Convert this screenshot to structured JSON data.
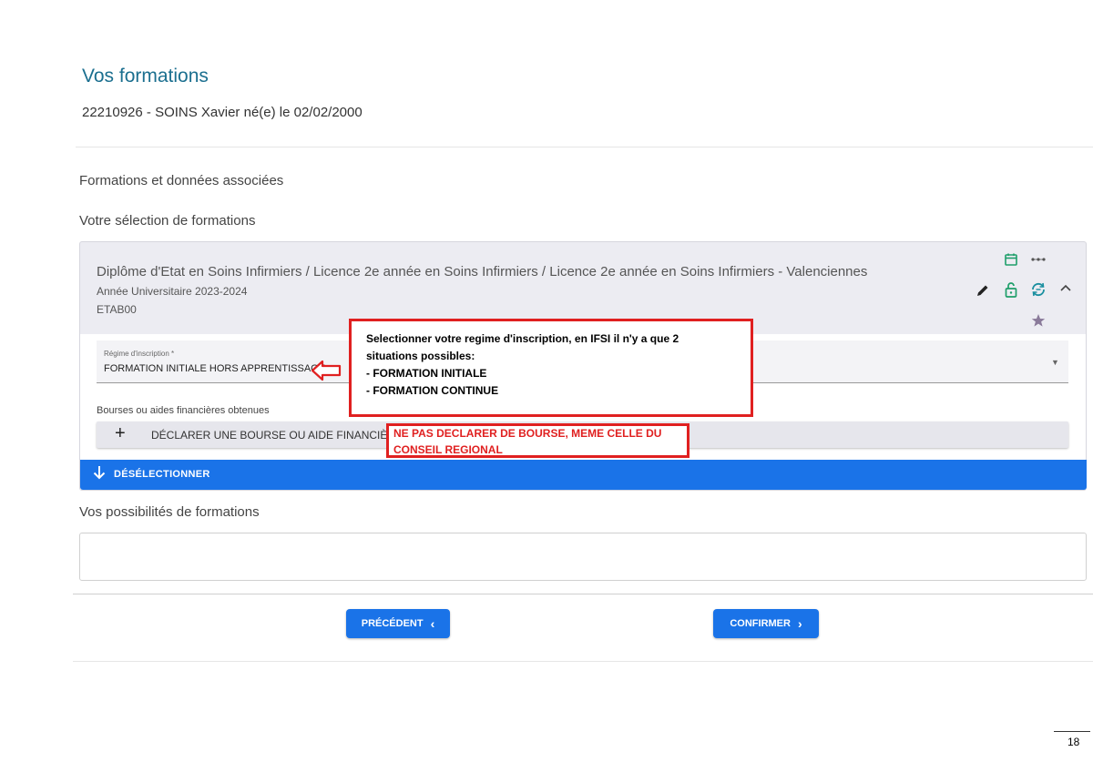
{
  "page": {
    "title": "Vos formations",
    "student": "22210926 - SOINS Xavier né(e) le 02/02/2000",
    "page_number": "18"
  },
  "sections": {
    "formations": "Formations et données associées",
    "selection": "Votre sélection de formations",
    "possibilites": "Vos possibilités de formations"
  },
  "formation": {
    "title": "Diplôme d'Etat en Soins Infirmiers / Licence 2e année en Soins Infirmiers / Licence 2e année en Soins Infirmiers - Valenciennes",
    "year": "Année Universitaire 2023-2024",
    "etab": "ETAB00",
    "icons": [
      "calendar-icon",
      "more-icon",
      "edit-icon",
      "lock-open-icon",
      "sync-icon",
      "chevron-up-icon",
      "star-icon"
    ],
    "icon_color_green": "#1e9e6a",
    "icon_color_teal": "#1a8fa0"
  },
  "regime": {
    "label": "Régime d'inscription *",
    "value": "FORMATION INITIALE HORS APPRENTISSAGE"
  },
  "bourses": {
    "label": "Bourses ou aides financières obtenues",
    "button": "DÉCLARER UNE BOURSE OU AIDE FINANCIÈRE"
  },
  "buttons": {
    "deselect": "DÉSÉLECTIONNER",
    "previous": "PRÉCÉDENT",
    "confirm": "CONFIRMER"
  },
  "annotations": {
    "regime_lines": [
      "Selectionner votre regime d'inscription, en IFSI il n'y a que 2",
      "situations possibles:",
      "- FORMATION INITIALE",
      "- FORMATION CONTINUE"
    ],
    "bourse_lines": [
      "NE PAS DECLARER DE BOURSE, MEME CELLE DU",
      "CONSEIL REGIONAL"
    ],
    "color": "#e02020"
  },
  "colors": {
    "primary": "#1a73e8",
    "title": "#1b6f8f"
  }
}
